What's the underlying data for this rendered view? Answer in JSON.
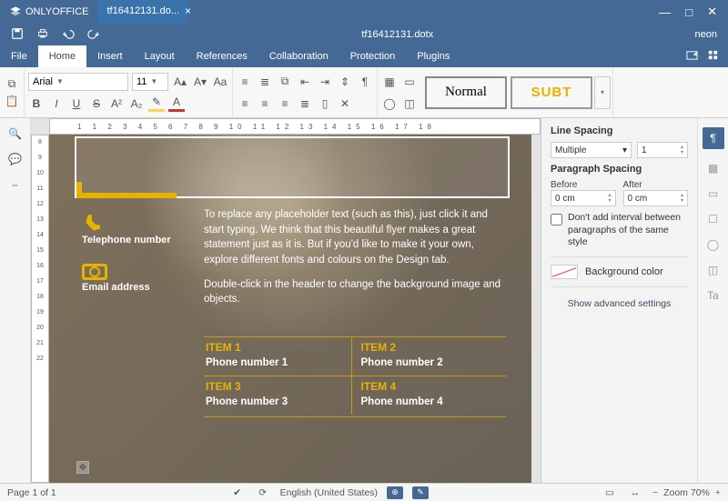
{
  "app": {
    "brand": "ONLYOFFICE",
    "tab_filename": "tf16412131.do...",
    "doc_title": "tf16412131.dotx",
    "user": "neon"
  },
  "menu": {
    "file": "File",
    "home": "Home",
    "insert": "Insert",
    "layout": "Layout",
    "references": "References",
    "collaboration": "Collaboration",
    "protection": "Protection",
    "plugins": "Plugins"
  },
  "toolbar": {
    "font_name": "Arial",
    "font_size": "11",
    "styles": {
      "normal": "Normal",
      "subtitle": "SUBT"
    }
  },
  "document": {
    "contact": {
      "telephone_label": "Telephone number",
      "email_label": "Email address"
    },
    "para1": "To replace any placeholder text (such as this), just click it and start typing. We think that this beautiful flyer makes a great statement just as it is. But if you'd like to make it your own, explore different fonts and colours on the Design tab.",
    "para2": "Double-click in the header to change the background image and objects.",
    "items": [
      {
        "label": "ITEM 1",
        "phone": "Phone number 1"
      },
      {
        "label": "ITEM 2",
        "phone": "Phone number 2"
      },
      {
        "label": "ITEM 3",
        "phone": "Phone number 3"
      },
      {
        "label": "ITEM 4",
        "phone": "Phone number 4"
      }
    ]
  },
  "panel": {
    "line_spacing_title": "Line Spacing",
    "line_spacing_mode": "Multiple",
    "line_spacing_value": "1",
    "para_spacing_title": "Paragraph Spacing",
    "before_label": "Before",
    "after_label": "After",
    "before_value": "0 cm",
    "after_value": "0 cm",
    "no_interval_label": "Don't add interval between paragraphs of the same style",
    "bg_color_label": "Background color",
    "advanced": "Show advanced settings"
  },
  "status": {
    "page": "Page 1 of 1",
    "language": "English (United States)",
    "zoom_label": "Zoom 70%"
  },
  "ruler_h": "1   1   2   3   4   5   6   7   8   9  10  11  12  13  14  15  16  17  18",
  "ruler_v": [
    "8",
    "9",
    "10",
    "11",
    "12",
    "13",
    "14",
    "15",
    "16",
    "17",
    "18",
    "19",
    "20",
    "21",
    "22"
  ]
}
